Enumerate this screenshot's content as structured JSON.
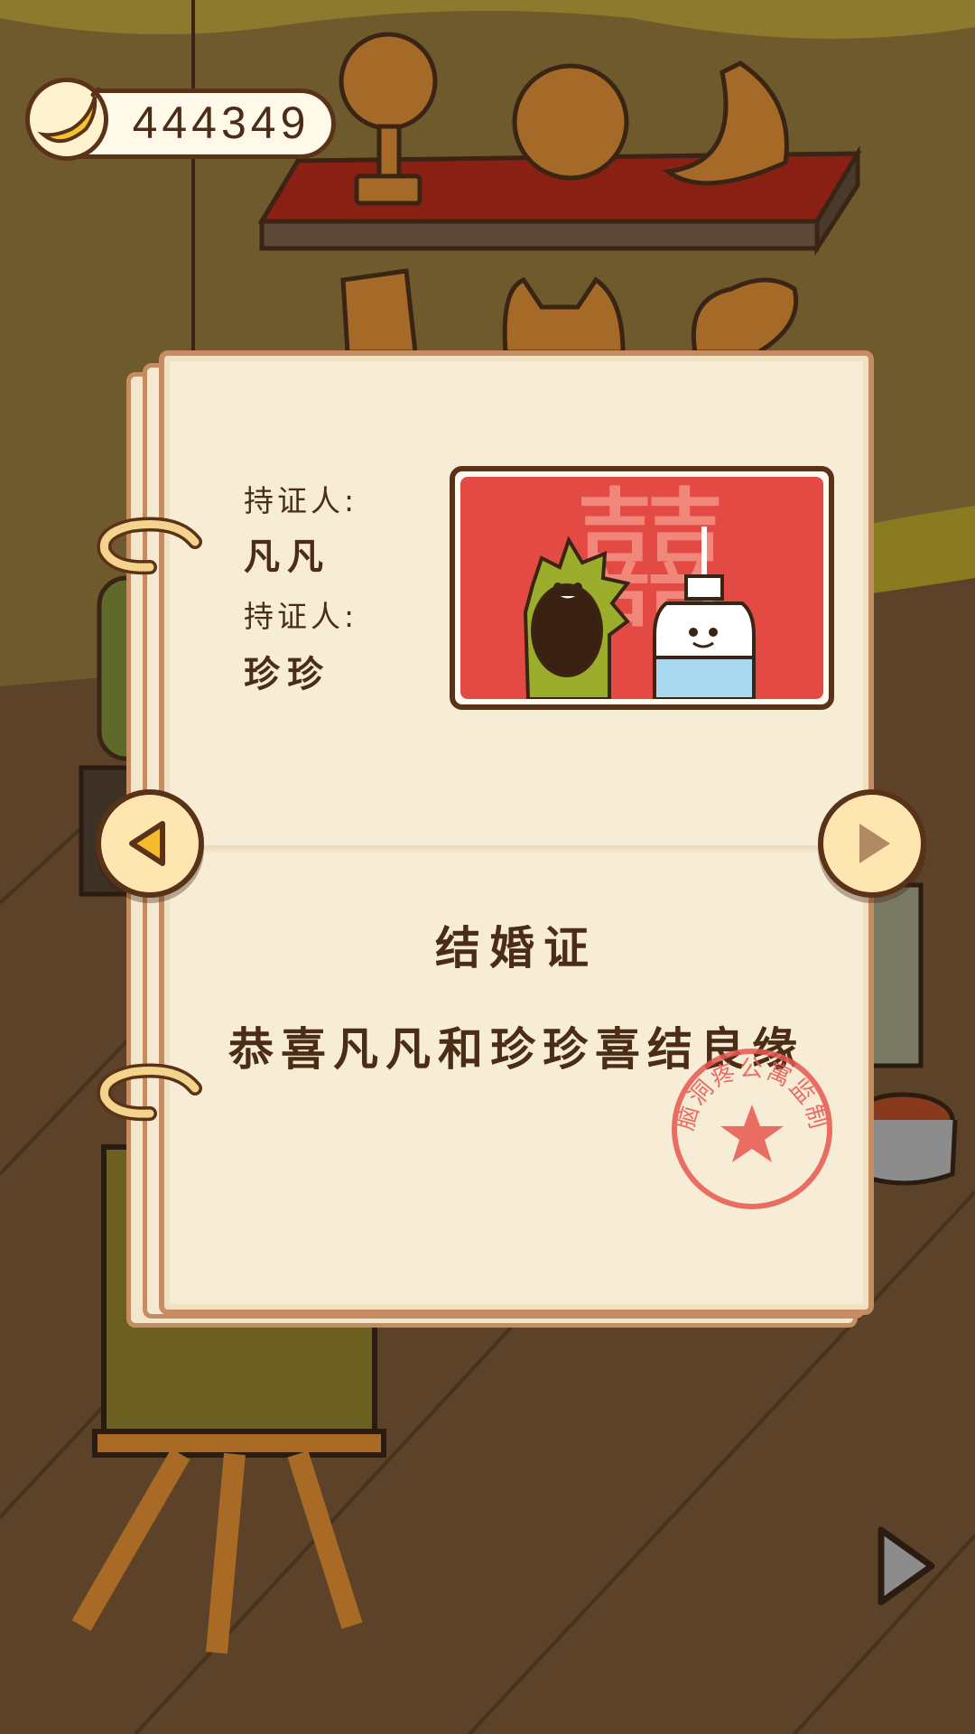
{
  "hud": {
    "banana_count": "444349",
    "banana_icon": "banana-icon"
  },
  "certificate": {
    "holder1_label": "持证人:",
    "holder1_name": "凡凡",
    "holder2_label": "持证人:",
    "holder2_name": "珍珍",
    "photo_character": "囍",
    "title": "结婚证",
    "message": "恭喜凡凡和珍珍喜结良缘",
    "seal_text": "脑洞疼公寓监制"
  },
  "navigation": {
    "prev_icon": "arrow-left-icon",
    "next_icon": "arrow-right-icon",
    "continue_icon": "play-arrow-icon"
  },
  "colors": {
    "wall": "#6e5a2c",
    "floor": "#5b4228",
    "paper": "#f7ecd6",
    "ink": "#4a2c17",
    "photo_red": "#e34a43",
    "seal_red": "#e8584f"
  }
}
